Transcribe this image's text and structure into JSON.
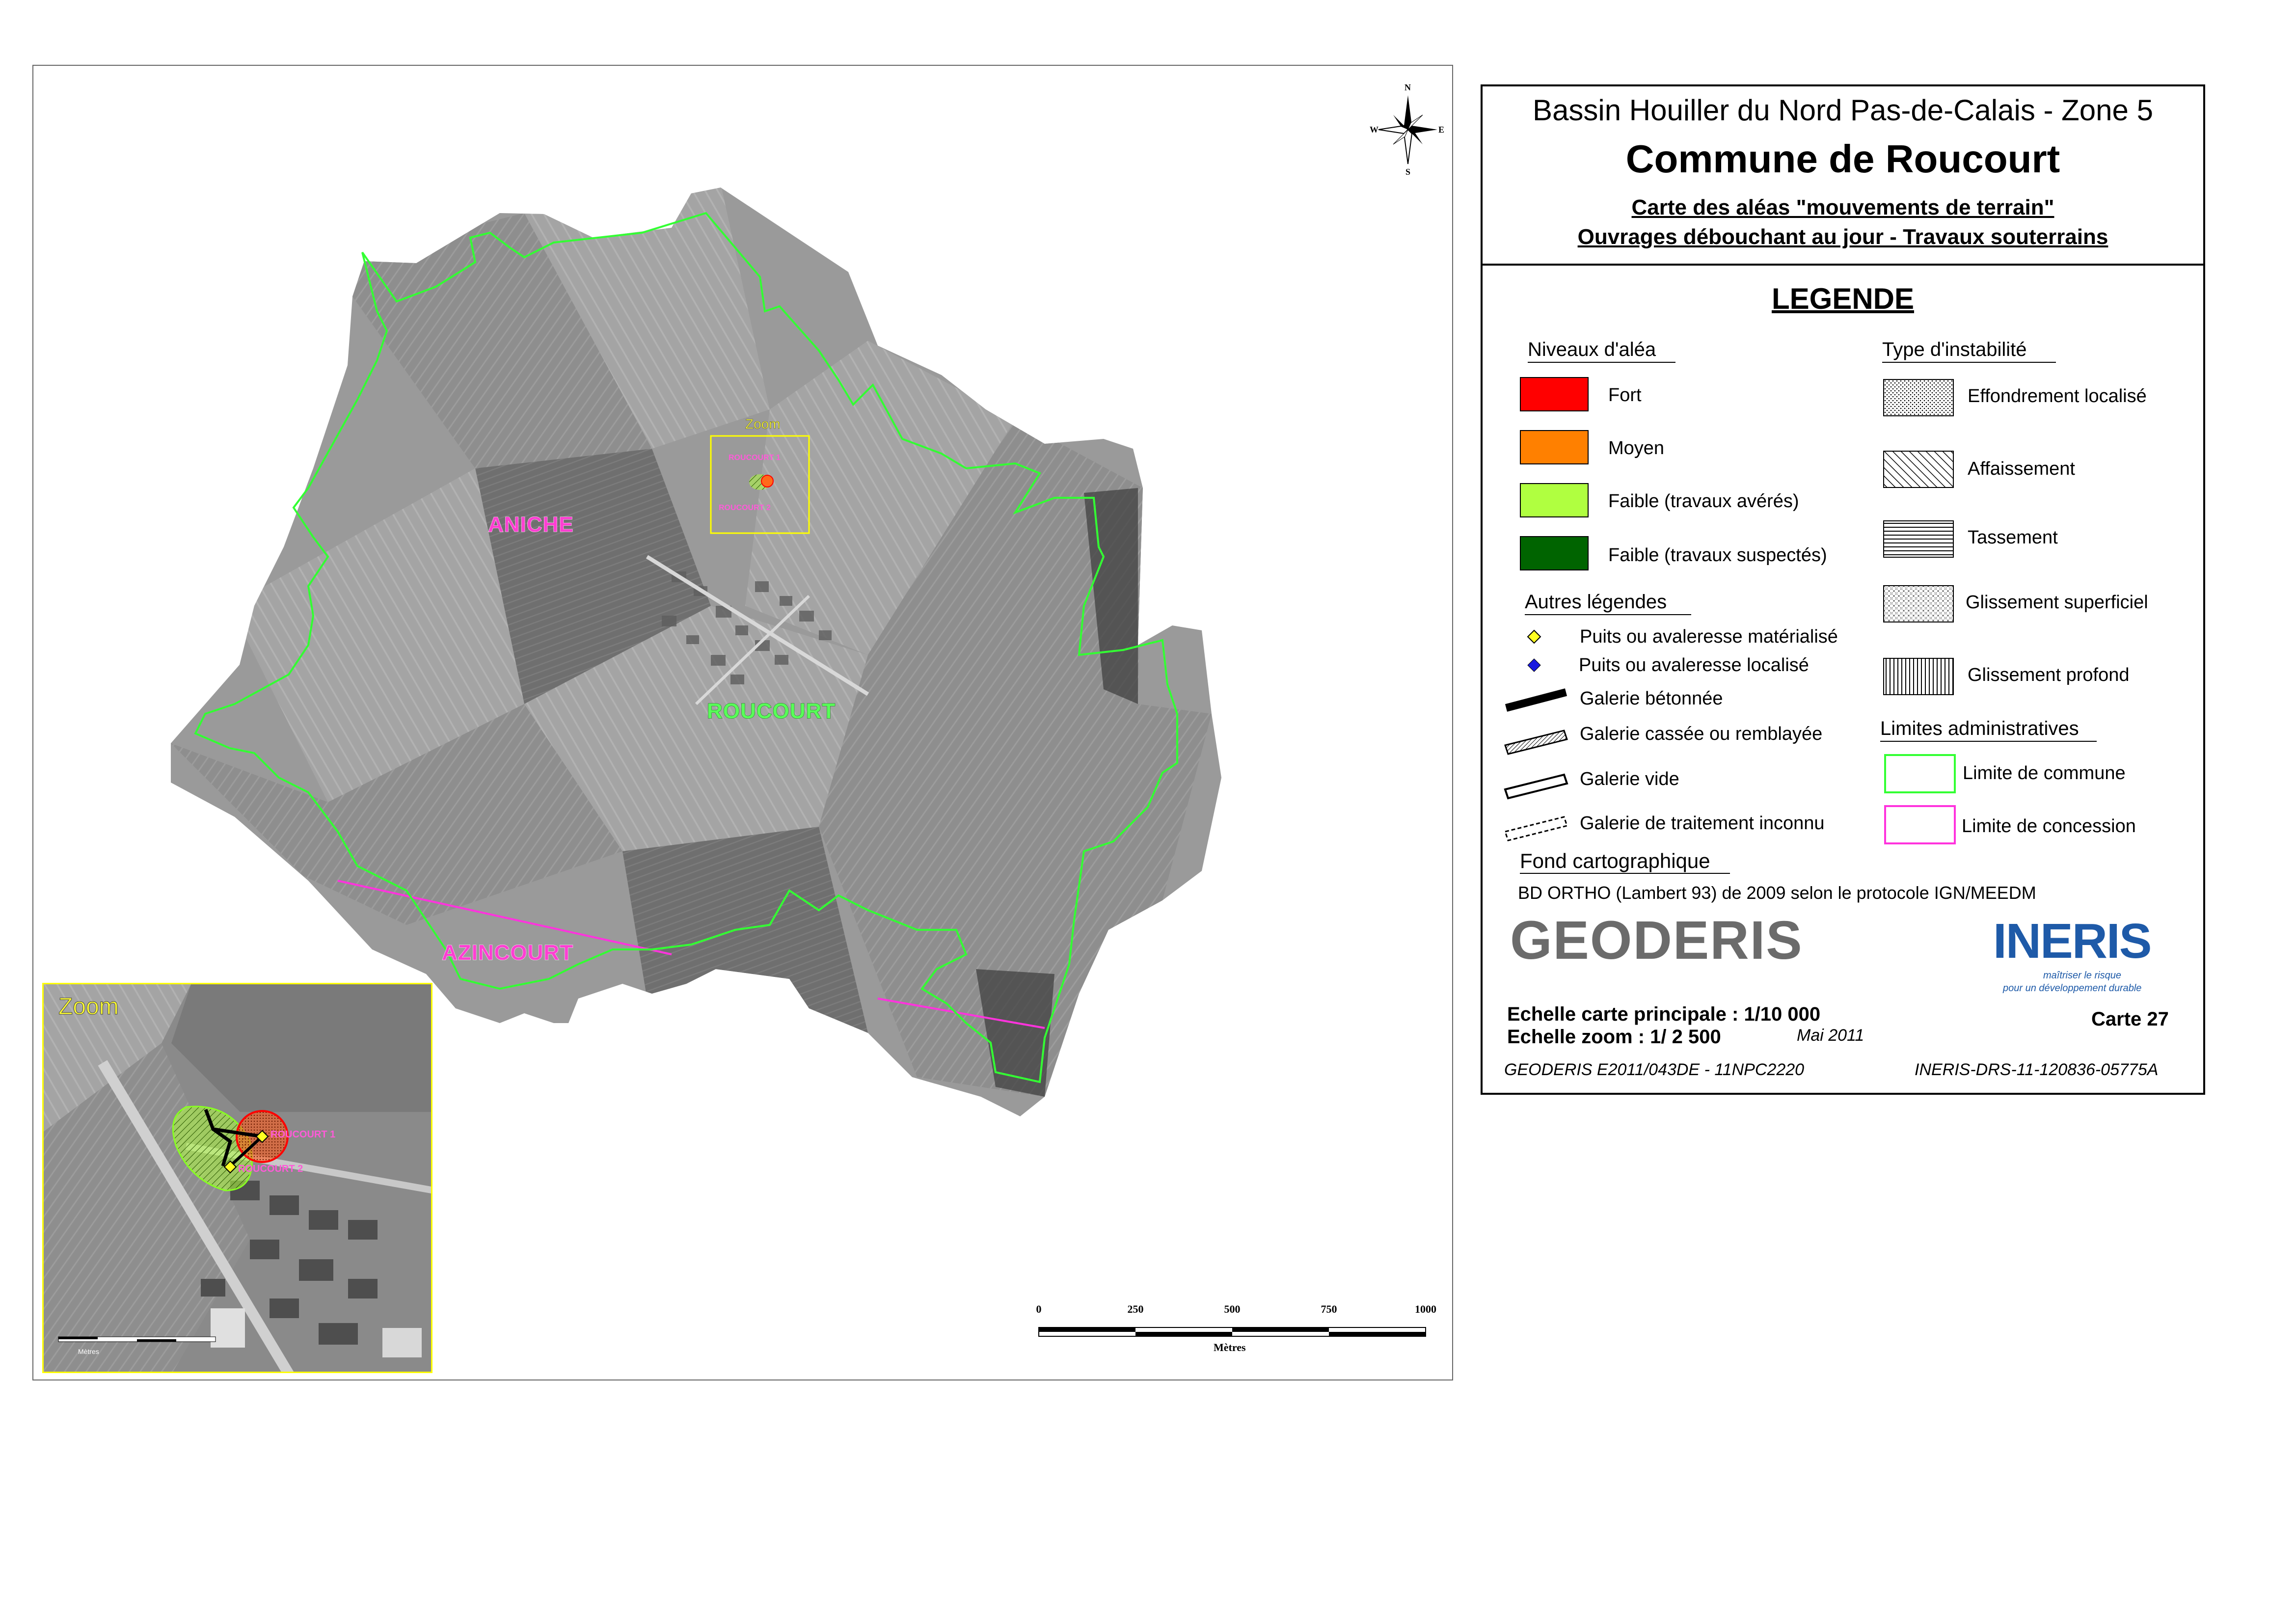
{
  "map": {
    "communes": {
      "aniche": "ANICHE",
      "roucourt": "ROUCOURT",
      "azincourt": "AZINCOURT"
    },
    "zoom_tag": "Zoom",
    "ouvrages": {
      "roucourt1": "ROUCOURT 1",
      "roucourt2": "ROUCOURT 2"
    },
    "inset": {
      "title": "Zoom",
      "ouvrage1": "ROUCOURT 1",
      "ouvrage2": "ROUCOURT 2",
      "scale_unit": "Mètres"
    },
    "scale_bar": {
      "ticks": [
        "0",
        "250",
        "500",
        "750",
        "1000"
      ],
      "unit": "Mètres"
    },
    "compass": {
      "n": "N",
      "s": "S",
      "e": "E",
      "w": "W"
    },
    "colors": {
      "commune_limit": "#33ff33",
      "concession_limit": "#ff33dd",
      "zoom_box": "#ffff00",
      "aleas_fort": "#ff0000",
      "aleas_faible": "#aaff44"
    }
  },
  "title": {
    "line1": "Bassin Houiller du Nord Pas-de-Calais - Zone 5",
    "line2": "Commune de Roucourt",
    "line3": "Carte des aléas \"mouvements de terrain\"",
    "line4": "Ouvrages débouchant au jour - Travaux souterrains"
  },
  "legend": {
    "heading": "LEGENDE",
    "niveaux_title": "Niveaux d'aléa",
    "niveaux": [
      {
        "label": "Fort",
        "color": "#ff0000"
      },
      {
        "label": "Moyen",
        "color": "#ff8000"
      },
      {
        "label": "Faible (travaux avérés)",
        "color": "#b0ff40"
      },
      {
        "label": "Faible (travaux suspectés)",
        "color": "#006400"
      }
    ],
    "instabilite_title": "Type d'instabilité",
    "instabilite": [
      "Effondrement  localisé",
      "Affaissement",
      "Tassement",
      "Glissement superficiel",
      "Glissement profond"
    ],
    "autres_title": "Autres légendes",
    "autres": [
      "Puits ou avaleresse matérialisé",
      "Puits ou avaleresse localisé",
      "Galerie bétonnée",
      "Galerie cassée ou remblayée",
      "Galerie vide",
      "Galerie de traitement inconnu"
    ],
    "limites_title": "Limites administratives",
    "limites": [
      {
        "label": "Limite de commune",
        "color": "#33ff33"
      },
      {
        "label": "Limite de concession",
        "color": "#ff33dd"
      }
    ],
    "fond_title": "Fond cartographique",
    "fond_text": "BD ORTHO (Lambert 93) de 2009 selon le protocole IGN/MEEDM"
  },
  "footer": {
    "geoderis": "GEODERIS",
    "ineris": "INERIS",
    "ineris_tag1": "maîtriser le risque",
    "ineris_tag2": "pour un développement durable",
    "scale_main": "Echelle carte principale : 1/10 000",
    "scale_zoom": "Echelle zoom : 1/ 2 500",
    "date": "Mai 2011",
    "carte": "Carte 27",
    "ref_left": "GEODERIS E2011/043DE - 11NPC2220",
    "ref_right": "INERIS-DRS-11-120836-05775A"
  }
}
